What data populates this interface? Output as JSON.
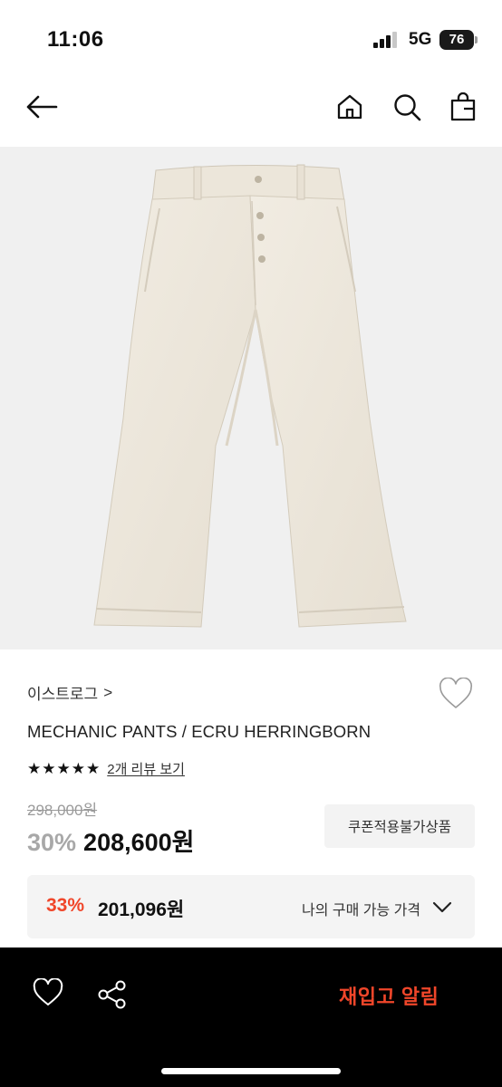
{
  "status": {
    "time": "11:06",
    "network": "5G",
    "battery": "76"
  },
  "nav": {
    "back_icon": "back-arrow-icon",
    "home_icon": "home-icon",
    "search_icon": "search-icon",
    "cart_icon": "shopping-bag-icon"
  },
  "product": {
    "brand": "이스트로그",
    "brand_chevron": ">",
    "title": "MECHANIC PANTS / ECRU HERRINGBORN",
    "rating": 5,
    "review_link": "2개 리뷰 보기",
    "original_price": "298,000원",
    "discount": "30%",
    "sale_price": "208,600원",
    "coupon_label": "쿠폰적용불가상품"
  },
  "best_price": {
    "discount": "33%",
    "price": "201,096원",
    "label": "나의 구매 가능 가격"
  },
  "bottom_bar": {
    "restock_label": "재입고 알림"
  },
  "colors": {
    "accent": "#f0462a",
    "muted": "#9a9a9a",
    "bar": "#000000"
  }
}
